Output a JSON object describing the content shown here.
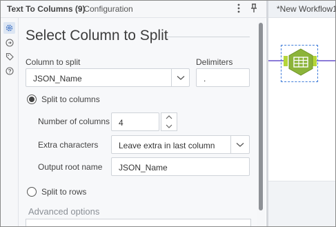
{
  "panel": {
    "tool_name": "Text To Columns (9)",
    "subtitle": "- Configuration",
    "menu_icon": "vertical-ellipsis-icon",
    "pin_icon": "pin-icon"
  },
  "rail": {
    "icons": [
      "gear-icon",
      "arrow-circle-icon",
      "tag-icon",
      "help-icon"
    ]
  },
  "config": {
    "heading": "Select Column to Split",
    "column_label": "Column to split",
    "column_value": "JSON_Name",
    "delimiters_label": "Delimiters",
    "delimiters_value": ".",
    "split_to_columns_label": "Split to columns",
    "split_to_columns_selected": true,
    "num_columns_label": "Number of columns",
    "num_columns_value": "4",
    "extra_chars_label": "Extra characters",
    "extra_chars_value": "Leave extra in last column",
    "output_root_label": "Output root name",
    "output_root_value": "JSON_Name",
    "split_to_rows_label": "Split to rows",
    "split_to_rows_selected": false,
    "advanced_label": "Advanced options"
  },
  "canvas": {
    "tab_title": "*New Workflow1",
    "tool_icon": "text-to-columns-tool-icon",
    "colors": {
      "tool_hex": "#8cb43a",
      "anchor": "#b5d63a",
      "connection": "#8b7bd8",
      "selection": "#3d7bd9"
    }
  }
}
